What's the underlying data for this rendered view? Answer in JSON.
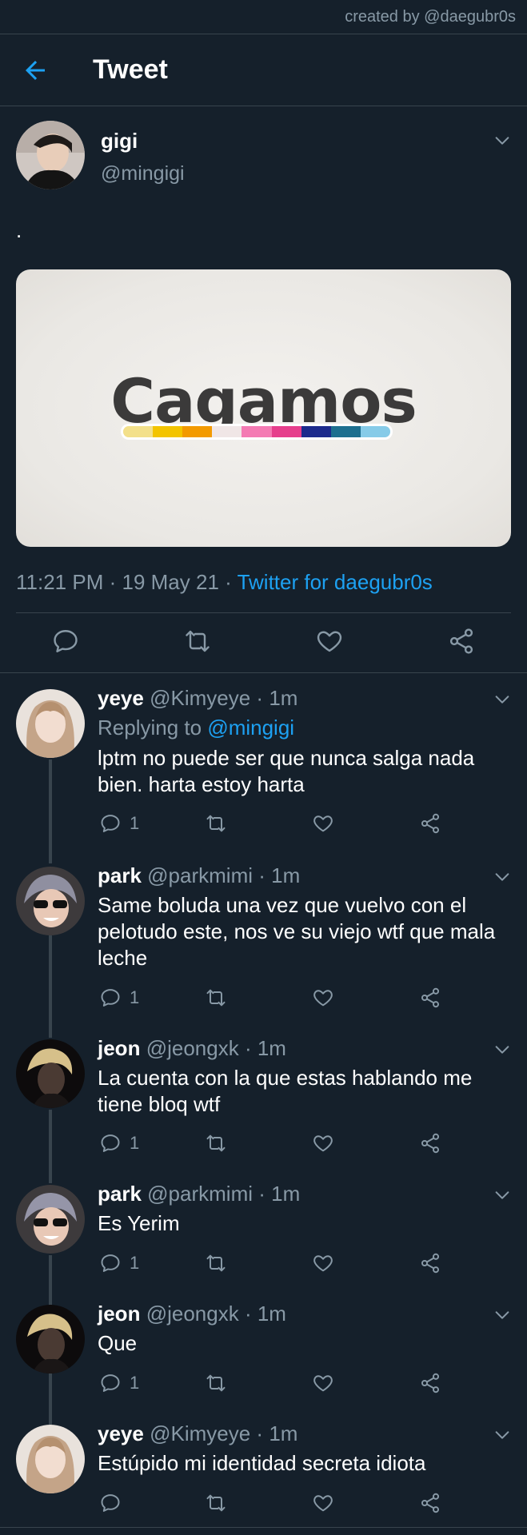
{
  "credit": "created by @daegubr0s",
  "header": {
    "title": "Tweet"
  },
  "main_tweet": {
    "name": "gigi",
    "handle": "@mingigi",
    "text": ".",
    "media": {
      "logo_text": "Cagamos",
      "stripe_colors": [
        "#f3e08a",
        "#f3c400",
        "#f39a00",
        "#f0e6e6",
        "#f47ab3",
        "#e63e8c",
        "#1c2a8c",
        "#1d6f8f",
        "#86cbe8"
      ]
    },
    "time": "11:21 PM",
    "date": "19 May 21",
    "source": "Twitter for daegubr0s",
    "sep": "·"
  },
  "replies": [
    {
      "name": "yeye",
      "handle": "@Kimyeye",
      "time": "1m",
      "replying_prefix": "Replying to",
      "replying_to": "@mingigi",
      "text": "lptm no puede ser que nunca salga nada bien. harta estoy harta",
      "reply_count": "1",
      "avatar": "light"
    },
    {
      "name": "park",
      "handle": "@parkmimi",
      "time": "1m",
      "text": "Same boluda una vez que vuelvo con el pelotudo este, nos ve su viejo wtf que mala leche",
      "reply_count": "1",
      "avatar": "sunglasses"
    },
    {
      "name": "jeon",
      "handle": "@jeongxk",
      "time": "1m",
      "text": "La cuenta con la que estas hablando me tiene bloq wtf",
      "reply_count": "1",
      "avatar": "dark"
    },
    {
      "name": "park",
      "handle": "@parkmimi",
      "time": "1m",
      "text": "Es Yerim",
      "reply_count": "1",
      "avatar": "sunglasses"
    },
    {
      "name": "jeon",
      "handle": "@jeongxk",
      "time": "1m",
      "text": "Que",
      "reply_count": "1",
      "avatar": "dark"
    },
    {
      "name": "yeye",
      "handle": "@Kimyeye",
      "time": "1m",
      "text": "Estúpido mi identidad secreta idiota",
      "reply_count": "",
      "avatar": "light"
    }
  ],
  "colors": {
    "background": "#15202b",
    "accent": "#1da1f2",
    "muted": "#8899a6",
    "divider": "#38444d"
  },
  "icons": [
    "back-arrow-icon",
    "chevron-down-icon",
    "reply-icon",
    "retweet-icon",
    "like-icon",
    "share-icon"
  ]
}
